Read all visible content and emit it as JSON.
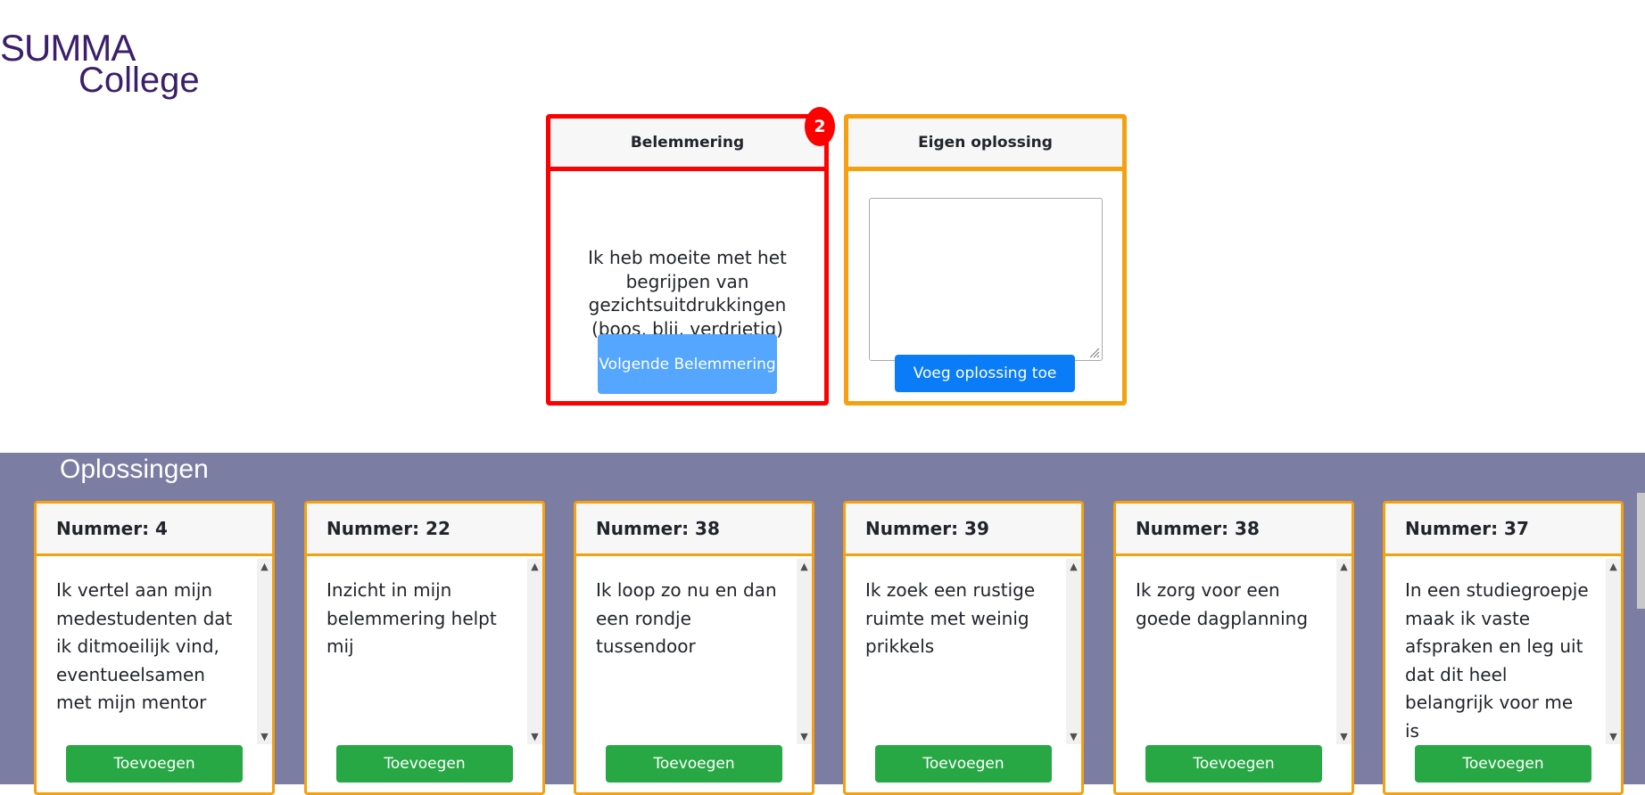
{
  "logo": {
    "line1": "SUMMA",
    "line2": "College"
  },
  "belemmering": {
    "header": "Belemmering",
    "badge": "2",
    "text": "Ik heb moeite met het begrijpen van gezichtsuitdrukkingen (boos, blij, verdrietig)",
    "next_button": "Volgende Belemmering"
  },
  "eigen": {
    "header": "Eigen oplossing",
    "textarea_value": "",
    "add_button": "Voeg oplossing toe"
  },
  "oplossingen": {
    "title": "Oplossingen",
    "cards": [
      {
        "header": "Nummer: 4",
        "text": "Ik vertel aan mijn medestudenten dat ik ditmoeilijk vind, eventueelsamen met mijn mentor",
        "button": "Toevoegen"
      },
      {
        "header": "Nummer: 22",
        "text": "Inzicht in mijn belemmering helpt mij",
        "button": "Toevoegen"
      },
      {
        "header": "Nummer: 38",
        "text": "Ik loop zo nu en dan een rondje tussendoor",
        "button": "Toevoegen"
      },
      {
        "header": "Nummer: 39",
        "text": "Ik zoek een rustige ruimte met weinig prikkels",
        "button": "Toevoegen"
      },
      {
        "header": "Nummer: 38",
        "text": "Ik zorg voor een goede dagplanning",
        "button": "Toevoegen"
      },
      {
        "header": "Nummer: 37",
        "text": "In een studiegroepje maak ik vaste afspraken en leg uit dat dit heel belangrijk voor me is",
        "button": "Toevoegen"
      }
    ]
  },
  "colors": {
    "red": "#ff0000",
    "orange": "#f5a00f",
    "band": "#7b7da3",
    "blue": "#0a7cf7",
    "green": "#28a745"
  }
}
